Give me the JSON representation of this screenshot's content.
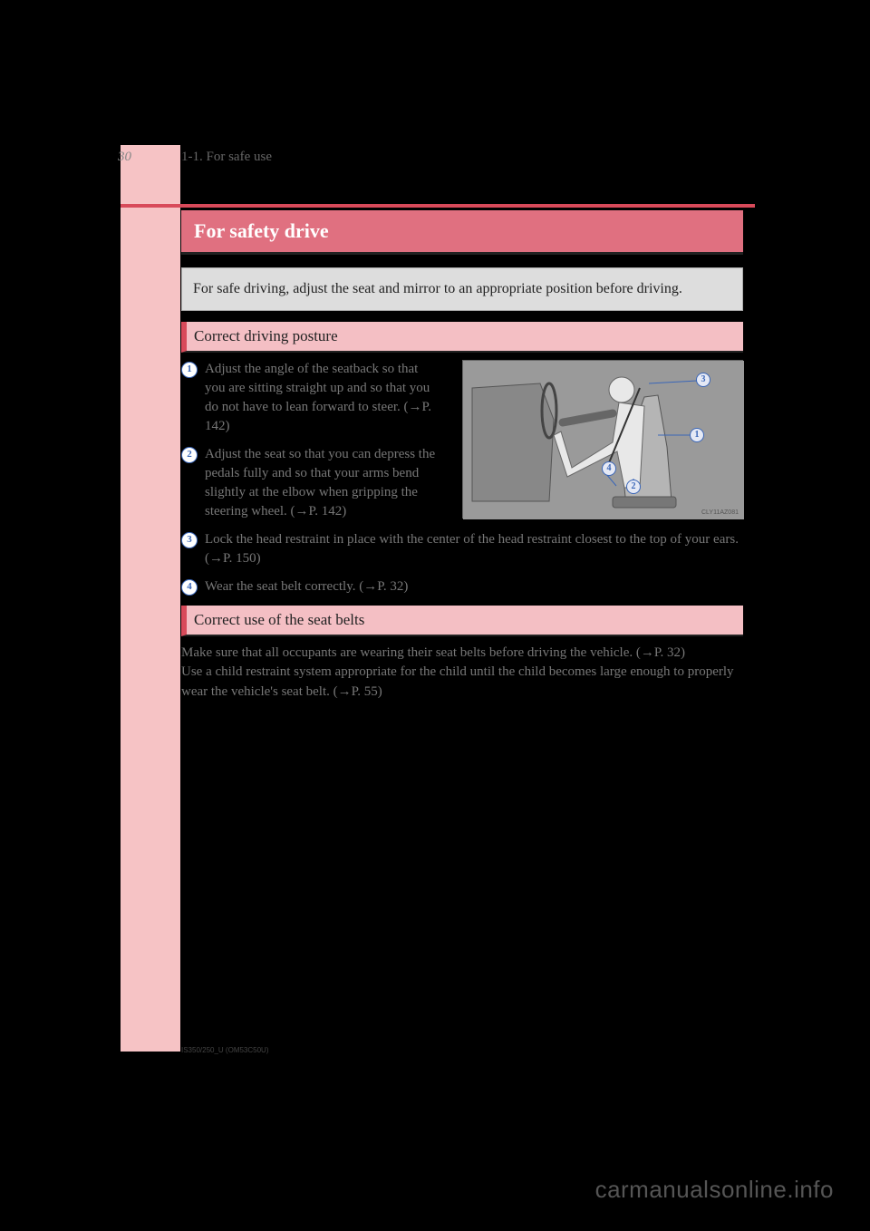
{
  "page_number": "30",
  "chapter": "1-1. For safe use",
  "title": "For safety drive",
  "intro": "For safe driving, adjust the seat and mirror to an appropriate position before driving.",
  "section_posture": "Correct driving posture",
  "posture_items": [
    "Adjust the angle of the seatback so that you are sitting straight up and so that you do not have to lean forward to steer. (→P. 142)",
    "Adjust the seat so that you can depress the pedals fully and so that your arms bend slightly at the elbow when gripping the steering wheel. (→P. 142)",
    "Lock the head restraint in place with the center of the head restraint closest to the top of your ears. (→P. 150)",
    "Wear the seat belt correctly. (→P. 32)"
  ],
  "section_seatbelt": "Correct use of the seat belts",
  "seatbelt_text": "Make sure that all occupants are wearing their seat belts before driving the vehicle. (→P. 32)\nUse a child restraint system appropriate for the child until the child becomes large enough to properly wear the vehicle's seat belt. (→P. 55)",
  "img_code": "CLY11AZ081",
  "footer_small": "IS350/250_U (OM53C50U)",
  "watermark": "carmanualsonline.info"
}
